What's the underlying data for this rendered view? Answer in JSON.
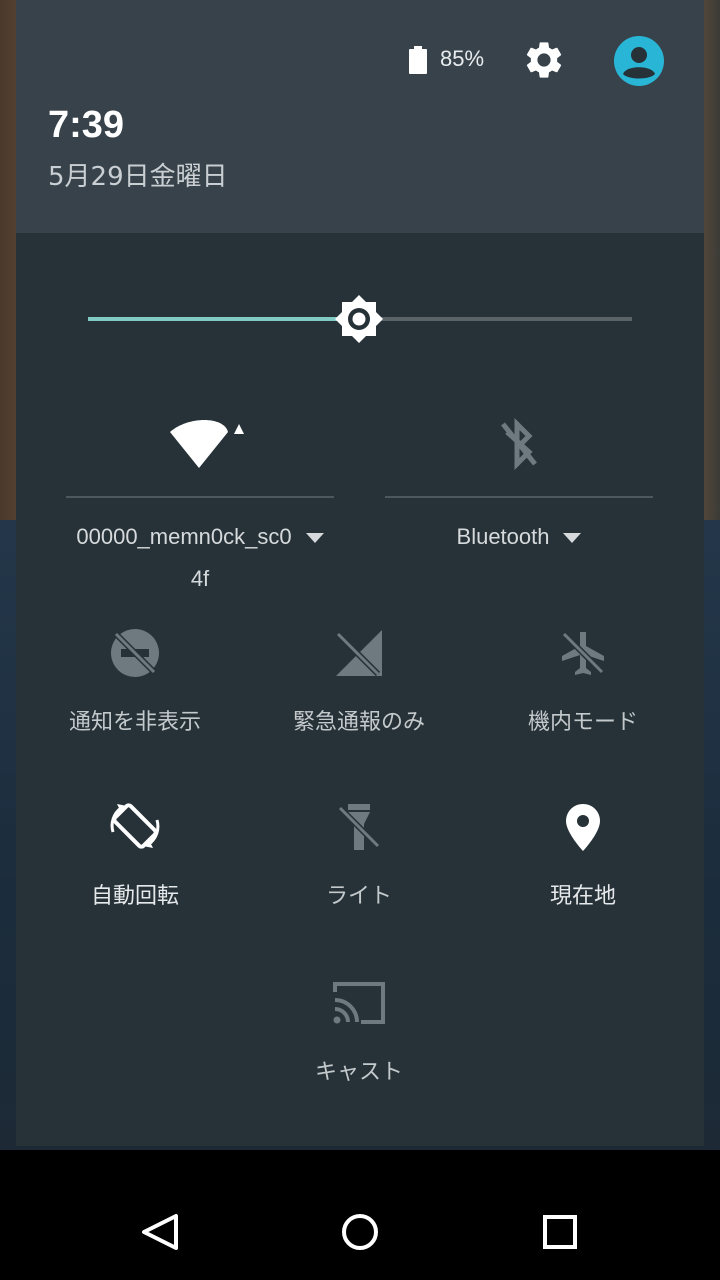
{
  "status": {
    "battery_percent": "85%"
  },
  "header": {
    "time": "7:39",
    "date": "5月29日金曜日"
  },
  "brightness": {
    "level": 0.5
  },
  "wifi": {
    "ssid_line1": "00000_memn0ck_sc0",
    "ssid_line2": "4f"
  },
  "bluetooth": {
    "label": "Bluetooth"
  },
  "tiles": [
    {
      "label": "通知を非表示",
      "icon": "do-not-disturb-off-icon",
      "active": false
    },
    {
      "label": "緊急通報のみ",
      "icon": "no-signal-icon",
      "active": false
    },
    {
      "label": "機内モード",
      "icon": "airplane-off-icon",
      "active": false
    },
    {
      "label": "自動回転",
      "icon": "auto-rotate-icon",
      "active": true
    },
    {
      "label": "ライト",
      "icon": "flashlight-off-icon",
      "active": false
    },
    {
      "label": "現在地",
      "icon": "location-icon",
      "active": true
    },
    {
      "label": "キャスト",
      "icon": "cast-icon",
      "active": false
    }
  ],
  "colors": {
    "accent": "#80cbc4",
    "avatar": "#29b6d6",
    "panel": "#263238",
    "header": "#37424a"
  }
}
